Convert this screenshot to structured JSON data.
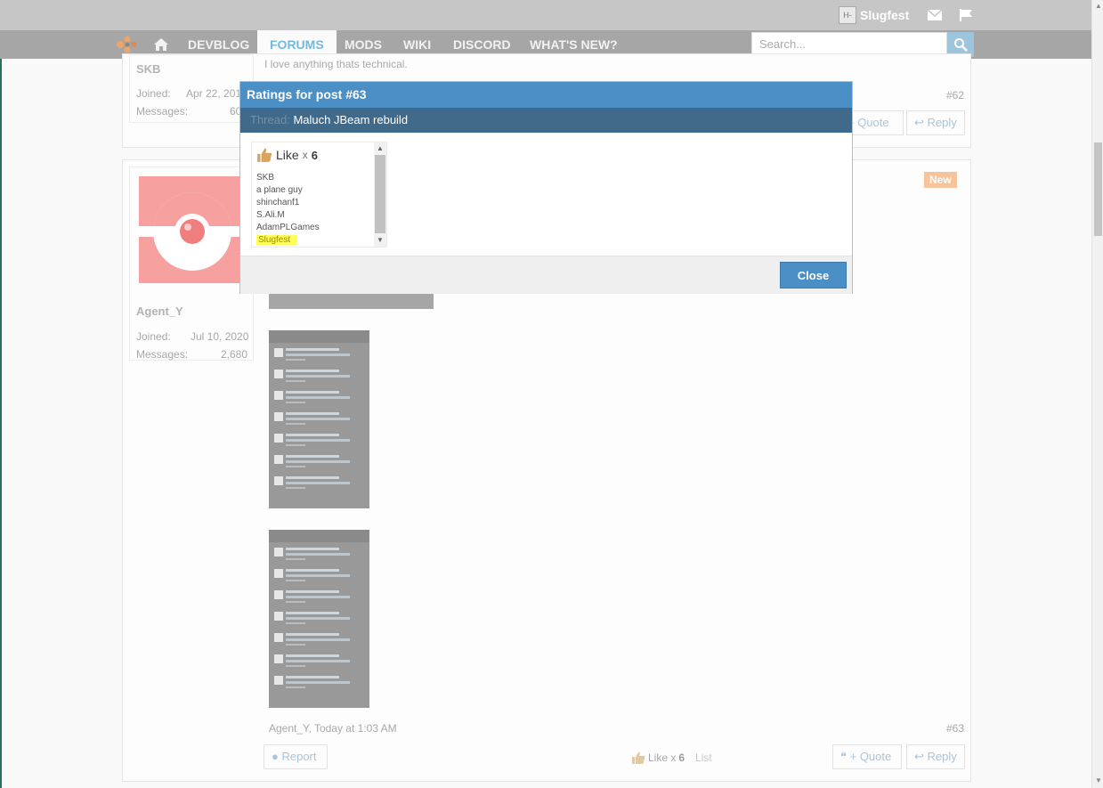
{
  "topbar": {
    "username": "Slugfest",
    "avatar_text": "H-"
  },
  "nav": {
    "items": [
      "DEVBLOG",
      "FORUMS",
      "MODS",
      "WIKI",
      "DISCORD",
      "WHAT'S NEW?"
    ],
    "active": "FORUMS",
    "search_placeholder": "Search..."
  },
  "post62": {
    "username": "SKB",
    "joined_label": "Joined:",
    "joined_value": "Apr 22, 201",
    "messages_label": "Messages:",
    "messages_value": "60",
    "signature": "I love anything thats technical.",
    "number": "#62",
    "quote_label": "+ Quote",
    "reply_label": "Reply"
  },
  "post63": {
    "username": "Agent_Y",
    "joined_label": "Joined:",
    "joined_value": "Jul 10, 2020",
    "messages_label": "Messages:",
    "messages_value": "2,680",
    "badge": "New",
    "meta": "Agent_Y, Today at 1:03 AM",
    "number": "#63",
    "report_label": "Report",
    "like_label": "Like x",
    "like_count": "6",
    "list_label": "List",
    "quote_label": "+ Quote",
    "reply_label": "Reply"
  },
  "modal": {
    "title": "Ratings for post #63",
    "thread_label": "Thread:",
    "thread_name": "Maluch JBeam rebuild",
    "rating_name": "Like",
    "rating_x": "x",
    "rating_count": "6",
    "users": [
      "SKB",
      "a plane guy",
      "shinchanf1",
      "S.Ali.M",
      "AdamPLGames",
      "Slugfest"
    ],
    "close_label": "Close"
  },
  "colors": {
    "accent": "#4a8fc5",
    "thread_bar": "#3f6a8c",
    "highlight": "#ffff5a",
    "new_badge": "#f6c49a"
  }
}
